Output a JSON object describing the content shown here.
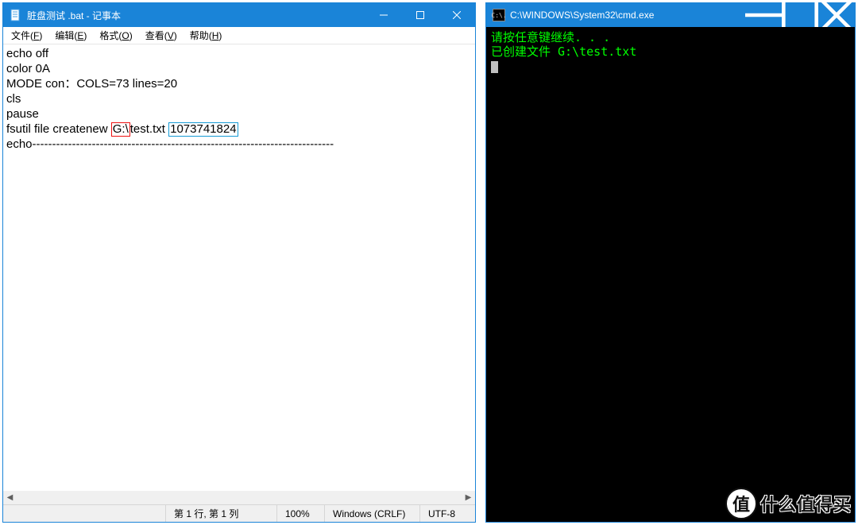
{
  "notepad": {
    "title": "脏盘测试 .bat - 记事本",
    "menu": {
      "file": {
        "label": "文件(",
        "hotkey": "F",
        "suffix": ")"
      },
      "edit": {
        "label": "编辑(",
        "hotkey": "E",
        "suffix": ")"
      },
      "format": {
        "label": "格式(",
        "hotkey": "O",
        "suffix": ")"
      },
      "view": {
        "label": "查看(",
        "hotkey": "V",
        "suffix": ")"
      },
      "help": {
        "label": "帮助(",
        "hotkey": "H",
        "suffix": ")"
      }
    },
    "content": {
      "l1": "echo off",
      "l2": "color 0A",
      "l3": "MODE con：COLS=73 lines=20",
      "l4": "cls",
      "l5": "pause",
      "l6_prefix": "fsutil file createnew ",
      "l6_drive": "G:\\",
      "l6_mid": "test.txt ",
      "l6_size": "1073741824",
      "l7_prefix": "echo",
      "l7_dashes": "----------------------------------------------------------------------------"
    },
    "status": {
      "pos": "第 1 行, 第 1 列",
      "zoom": "100%",
      "eol": "Windows (CRLF)",
      "enc": "UTF-8"
    }
  },
  "cmd": {
    "title": "C:\\WINDOWS\\System32\\cmd.exe",
    "icon_text": "C:\\.",
    "lines": [
      "请按任意键继续. . .",
      "已创建文件 G:\\test.txt"
    ]
  },
  "watermark": {
    "badge_char": "值",
    "text": "什么值得买"
  }
}
